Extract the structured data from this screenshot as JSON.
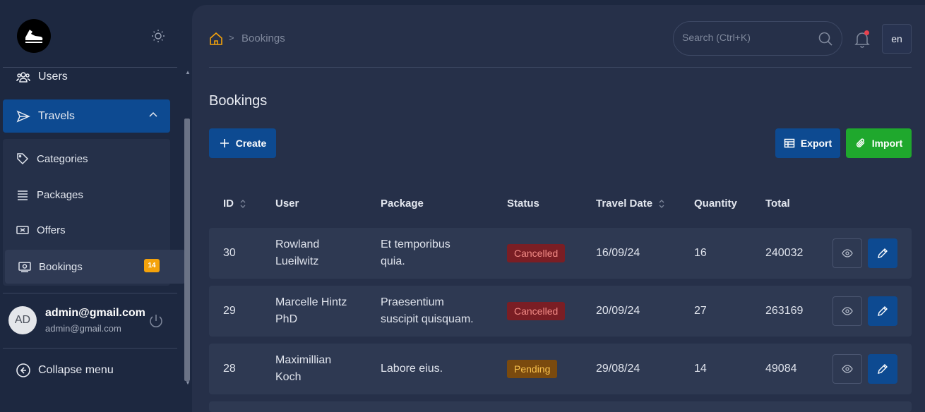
{
  "sidebar": {
    "users": "Users",
    "travels": "Travels",
    "sub_items": [
      {
        "label": "Categories",
        "icon": "tag-icon"
      },
      {
        "label": "Packages",
        "icon": "list-icon"
      },
      {
        "label": "Offers",
        "icon": "ticket-icon"
      },
      {
        "label": "Bookings",
        "icon": "booking-icon",
        "badge": "14"
      }
    ],
    "user": {
      "initials": "AD",
      "name": "admin@gmail.com",
      "email": "admin@gmail.com"
    },
    "collapse": "Collapse menu"
  },
  "header": {
    "breadcrumb_current": "Bookings",
    "breadcrumb_sep": ">",
    "search_placeholder": "Search (Ctrl+K)",
    "lang": "en"
  },
  "page": {
    "title": "Bookings",
    "create": "Create",
    "export": "Export",
    "import": "Import"
  },
  "table": {
    "columns": [
      "ID",
      "User",
      "Package",
      "Status",
      "Travel Date",
      "Quantity",
      "Total"
    ],
    "rows": [
      {
        "id": "30",
        "user1": "Rowland",
        "user2": "Lueilwitz",
        "pkg1": "Et temporibus",
        "pkg2": "quia.",
        "status": "Cancelled",
        "date": "16/09/24",
        "qty": "16",
        "total": "240032"
      },
      {
        "id": "29",
        "user1": "Marcelle Hintz",
        "user2": "PhD",
        "pkg1": "Praesentium",
        "pkg2": "suscipit quisquam.",
        "status": "Cancelled",
        "date": "20/09/24",
        "qty": "27",
        "total": "263169"
      },
      {
        "id": "28",
        "user1": "Maximillian",
        "user2": "Koch",
        "pkg1": "Labore eius.",
        "pkg2": "",
        "status": "Pending",
        "date": "29/08/24",
        "qty": "14",
        "total": "49084"
      }
    ]
  },
  "colors": {
    "accent": "#0d4a91",
    "import": "#1fa82d",
    "badge": "#f4a20b",
    "home": "#f4a20b"
  }
}
